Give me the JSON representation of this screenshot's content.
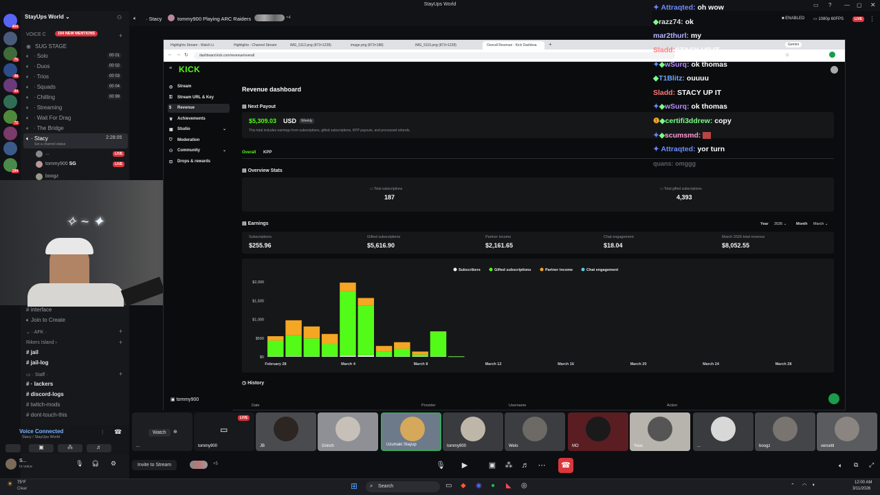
{
  "window": {
    "title": "StayUps World"
  },
  "server_rail": {
    "badges": [
      "404",
      "75",
      "48",
      "44",
      "72",
      "194"
    ]
  },
  "sidebar": {
    "server_name": "StayUps World",
    "mentions_badge": "194 NEW MENTIONS",
    "voice_category": "VOICE C",
    "stage": "SUG STAGE",
    "channels": [
      {
        "label": "Solo",
        "count": "00 01"
      },
      {
        "label": "Duos",
        "count": "00 02"
      },
      {
        "label": "Trios",
        "count": "00 03"
      },
      {
        "label": "Squads",
        "count": "00 04"
      },
      {
        "label": "Chilling",
        "count": "00 99"
      },
      {
        "label": "Streaming"
      },
      {
        "label": "Wait For Drag"
      },
      {
        "label": "The Bridge"
      }
    ],
    "active_channel": {
      "label": "Stacy",
      "time": "2:28:05",
      "status": "Set a channel status"
    },
    "members": [
      {
        "name": "...",
        "live": "LIVE"
      },
      {
        "name": "tommy900",
        "tag": "SG",
        "live": "LIVE"
      },
      {
        "name": "boogz"
      }
    ],
    "lower": {
      "interface": "interface",
      "join": "Join to Create",
      "afk": "AFK",
      "rikers": "Rikers Island",
      "jail": "jail",
      "jail_log": "jail-log",
      "staff": "Staff",
      "lackers": "lackers",
      "discord_logs": "discord-logs",
      "twitch_mods": "twitch-mods",
      "dont_touch": "dont-touch-this"
    },
    "voice": {
      "status": "Voice Connected",
      "detail": "Stacy / StayUps World"
    },
    "user": {
      "name": "S...",
      "sub": "In voice"
    }
  },
  "main_header": {
    "channel": "Stacy",
    "activity": "tommy900 Playing ARC Raiders",
    "extra": "+4"
  },
  "browser": {
    "tabs": [
      "Highlights Stream - Watch Li",
      "Highlights - Channel Stream",
      "IMG_5112.png (873×1228)",
      "image.png (873×188)",
      "IMG_5115.png (873×1228)",
      "Overall Revenue - Kick Dashboa"
    ],
    "url": "dashboard.kick.com/revenue/overall",
    "profile": "Gemini"
  },
  "kick": {
    "logo": "KICK",
    "nav": [
      "Stream",
      "Stream URL & Key",
      "Revenue",
      "Achievements",
      "Studio",
      "Moderation",
      "Community",
      "Drops & rewards"
    ],
    "footer_user": "tommy900",
    "page_title": "Revenue dashboard",
    "next_payout": {
      "heading": "Next Payout",
      "amount": "$5,309.03",
      "currency": "USD",
      "period": "Weekly",
      "note": "This total includes earnings from subscriptions, gifted subscriptions, KPP payouts, and processed refunds."
    },
    "tabs": [
      "Overall",
      "KPP"
    ],
    "overview": {
      "heading": "Overview Stats",
      "items": [
        {
          "label": "Total subscriptions",
          "value": "187"
        },
        {
          "label": "Total gifted subscriptions",
          "value": "4,393"
        }
      ]
    },
    "earnings": {
      "heading": "Earnings",
      "year_label": "Year",
      "year": "2026",
      "month_label": "Month",
      "month": "March",
      "stats": [
        {
          "label": "Subscriptions",
          "value": "$255.96"
        },
        {
          "label": "Gifted subscriptions",
          "value": "$5,616.90"
        },
        {
          "label": "Partner income",
          "value": "$2,161.65"
        },
        {
          "label": "Chat engagement",
          "value": "$18.04"
        },
        {
          "label": "March 2026 total revenue",
          "value": "$8,052.55"
        }
      ]
    },
    "history": {
      "heading": "History",
      "cols": [
        "Date",
        "Provider",
        "Username",
        "Action"
      ]
    }
  },
  "chart_data": {
    "type": "bar",
    "stacked": true,
    "legend": [
      "Subscribers",
      "Gifted subscriptions",
      "Partner income",
      "Chat engagement"
    ],
    "colors": {
      "Subscribers": "#f2f3f5",
      "Gifted subscriptions": "#53fc18",
      "Partner income": "#f5a623",
      "Chat engagement": "#4fd1e8"
    },
    "ylim": [
      0,
      2000
    ],
    "yticks": [
      "$0",
      "$500",
      "$1,000",
      "$1,500",
      "$2,000"
    ],
    "xticks": [
      "February 28",
      "March 4",
      "March 8",
      "March 12",
      "March 16",
      "March 20",
      "March 24",
      "March 28"
    ],
    "categories": [
      "Feb 28",
      "Mar 1",
      "Mar 2",
      "Mar 3",
      "Mar 4",
      "Mar 5",
      "Mar 6",
      "Mar 7",
      "Mar 8",
      "Mar 9",
      "Mar 10"
    ],
    "series": [
      {
        "name": "Subscribers",
        "values": [
          10,
          15,
          10,
          10,
          30,
          40,
          10,
          10,
          10,
          10,
          5
        ]
      },
      {
        "name": "Gifted subscriptions",
        "values": [
          420,
          560,
          480,
          330,
          1720,
          1330,
          130,
          200,
          50,
          650,
          10
        ]
      },
      {
        "name": "Partner income",
        "values": [
          120,
          400,
          320,
          270,
          230,
          200,
          150,
          180,
          80,
          20,
          0
        ]
      },
      {
        "name": "Chat engagement",
        "values": [
          0,
          0,
          0,
          0,
          0,
          0,
          0,
          0,
          0,
          0,
          0
        ]
      }
    ]
  },
  "chat": {
    "messages": [
      {
        "user": "Attraqted:",
        "text": "oh wow",
        "color": "#6c8cff"
      },
      {
        "user": "razz74:",
        "text": "ok",
        "color": "#ffffff"
      },
      {
        "user": "mar2thurl:",
        "text": "my",
        "color": "#b2b4ff"
      },
      {
        "user": "Sladd:",
        "text": "STACY UP IT",
        "color": "#ff7a7a"
      },
      {
        "user": "wSurq:",
        "text": "ok thomas",
        "color": "#b98cff"
      },
      {
        "user": "T1Blitz:",
        "text": "ouuuu",
        "color": "#6aa8ff"
      },
      {
        "user": "Sladd:",
        "text": "STACY UP IT",
        "color": "#ff7a7a"
      },
      {
        "user": "wSurq:",
        "text": "ok thomas",
        "color": "#b98cff"
      },
      {
        "user": "certifi3ddrew:",
        "text": "copy",
        "color": "#7bff8a"
      },
      {
        "user": "scumsmd:",
        "text": "",
        "color": "#ff9ad5"
      },
      {
        "user": "Attraqted:",
        "text": "yor turn",
        "color": "#6c8cff"
      },
      {
        "user": "quans:",
        "text": "omggg",
        "color": "#8a8c90"
      }
    ]
  },
  "topright": {
    "enabled": "ENABLED",
    "quality": "1080p 60FPS",
    "live": "LIVE"
  },
  "streams": {
    "watch": "Watch",
    "tiles": [
      {
        "name": "...",
        "live": ""
      },
      {
        "name": "tommy900",
        "live": "LIVE"
      },
      {
        "name": "JB"
      },
      {
        "name": "Grinch"
      },
      {
        "name": "Uzumaki Stayup"
      },
      {
        "name": "tommy900"
      },
      {
        "name": "Welo"
      },
      {
        "name": "MO"
      },
      {
        "name": "Yous"
      },
      {
        "name": "..."
      },
      {
        "name": "boogz"
      },
      {
        "name": "vercetti"
      }
    ]
  },
  "bottom": {
    "invite": "Invite to Stream",
    "extra": "+5"
  },
  "taskbar": {
    "weather": "75°F",
    "weather_sub": "Clear",
    "search": "Search",
    "time": "12:00 AM",
    "date": "3/11/2026"
  }
}
